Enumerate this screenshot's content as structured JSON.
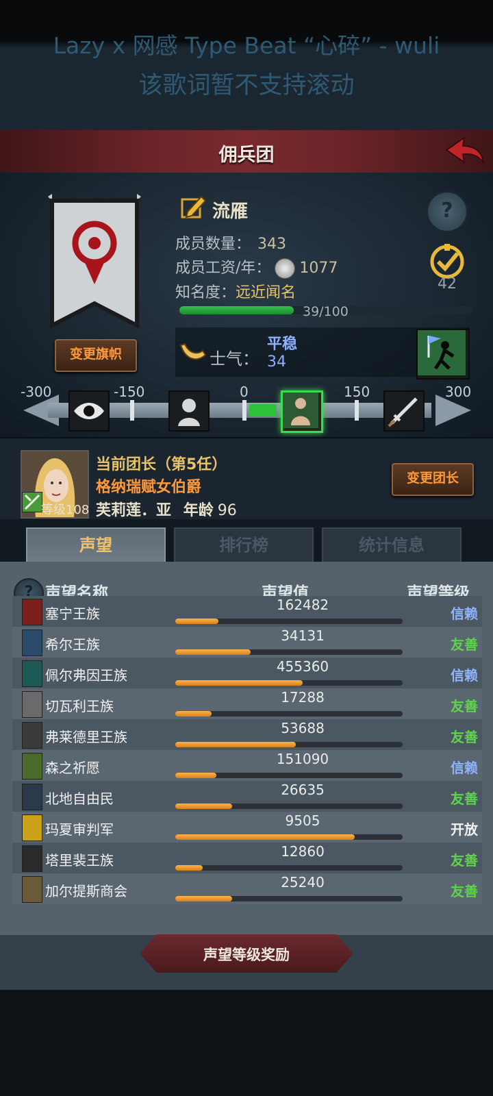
{
  "lyrics": {
    "line1": "Lazy x 网感 Type Beat “心碎” - wuli",
    "line2": "该歌词暂不支持滚动"
  },
  "header": {
    "title": "佣兵团"
  },
  "guild": {
    "name": "流雁",
    "members_label": "成员数量：",
    "members_value": "343",
    "wage_label": "成员工资/年：",
    "wage_value": "1077",
    "fame_label": "知名度：",
    "fame_value": "远近闻名",
    "fame_progress_text": "39/100",
    "fame_progress": 0.39,
    "badge_value": "42",
    "change_flag": "变更旗帜"
  },
  "morale": {
    "label": "士气：",
    "state": "平稳",
    "value": "34",
    "scale_labels": [
      "-300",
      "-150",
      "0",
      "150",
      "300"
    ],
    "icons": [
      "eye-icon",
      "despair-icon",
      "calm-figure-icon",
      "sword-icon"
    ]
  },
  "leader": {
    "title": "当前团长（第5任）",
    "rank_name": "格纳瑞赋女伯爵",
    "name": "芙莉莲．亚",
    "age_label": "年龄",
    "age_value": "96",
    "level_text": "等级108",
    "change_button": "变更团长"
  },
  "tabs": [
    {
      "label": "声望"
    },
    {
      "label": "排行榜"
    },
    {
      "label": "统计信息"
    }
  ],
  "reputation": {
    "headers": {
      "name": "声望名称",
      "value": "声望值",
      "level": "声望等级"
    },
    "rows": [
      {
        "name": "塞宁王族",
        "value": "162482",
        "fill": 0.19,
        "level": "信赖",
        "level_color": "#8fb4ff",
        "icon_color": "#7a1f1a"
      },
      {
        "name": "希尔王族",
        "value": "34131",
        "fill": 0.33,
        "level": "友善",
        "level_color": "#5fd34e",
        "icon_color": "#2a4a6a"
      },
      {
        "name": "佩尔弗因王族",
        "value": "455360",
        "fill": 0.56,
        "level": "信赖",
        "level_color": "#8fb4ff",
        "icon_color": "#1e5a55"
      },
      {
        "name": "切瓦利王族",
        "value": "17288",
        "fill": 0.16,
        "level": "友善",
        "level_color": "#5fd34e",
        "icon_color": "#6a6a6a"
      },
      {
        "name": "弗莱德里王族",
        "value": "53688",
        "fill": 0.53,
        "level": "友善",
        "level_color": "#5fd34e",
        "icon_color": "#3a3a3a"
      },
      {
        "name": "森之祈愿",
        "value": "151090",
        "fill": 0.18,
        "level": "信赖",
        "level_color": "#8fb4ff",
        "icon_color": "#4a6a2a"
      },
      {
        "name": "北地自由民",
        "value": "26635",
        "fill": 0.25,
        "level": "友善",
        "level_color": "#5fd34e",
        "icon_color": "#2a3a4a"
      },
      {
        "name": "玛夏审判军",
        "value": "9505",
        "fill": 0.79,
        "level": "开放",
        "level_color": "#f2f2f2",
        "icon_color": "#c9a21a"
      },
      {
        "name": "塔里裴王族",
        "value": "12860",
        "fill": 0.12,
        "level": "友善",
        "level_color": "#5fd34e",
        "icon_color": "#2a2a2a"
      },
      {
        "name": "加尔提斯商会",
        "value": "25240",
        "fill": 0.25,
        "level": "友善",
        "level_color": "#5fd34e",
        "icon_color": "#6a5a3a"
      }
    ]
  },
  "footer_button": "声望等级奖励"
}
